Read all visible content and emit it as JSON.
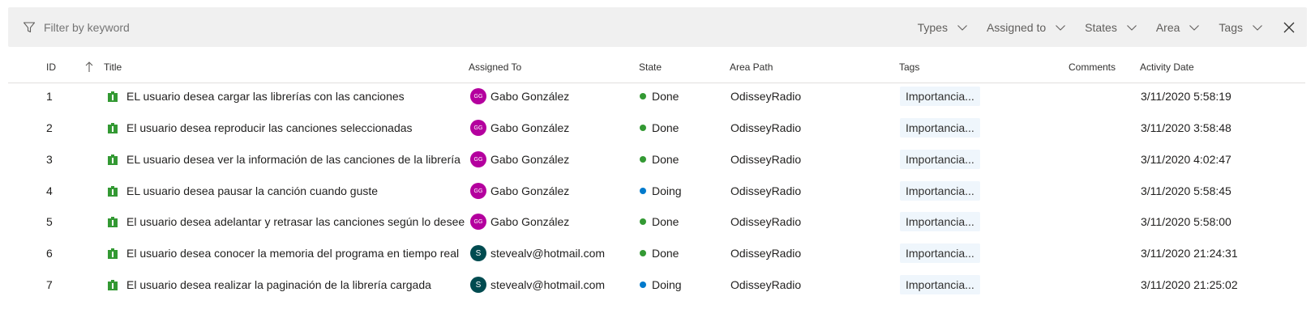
{
  "filter_bar": {
    "placeholder": "Filter by keyword",
    "dropdowns": [
      {
        "label": "Types"
      },
      {
        "label": "Assigned to"
      },
      {
        "label": "States"
      },
      {
        "label": "Area"
      },
      {
        "label": "Tags"
      }
    ]
  },
  "columns": {
    "id": "ID",
    "title": "Title",
    "assigned_to": "Assigned To",
    "state": "State",
    "area_path": "Area Path",
    "tags": "Tags",
    "comments": "Comments",
    "activity_date": "Activity Date"
  },
  "rows": [
    {
      "id": "1",
      "title": "EL usuario desea cargar las librerías con las canciones",
      "avatar": "GG",
      "assigned": "Gabo González",
      "state": "Done",
      "area": "OdisseyRadio",
      "tag": "Importancia...",
      "date": "3/11/2020 5:58:19"
    },
    {
      "id": "2",
      "title": "El usuario desea reproducir las canciones seleccionadas",
      "avatar": "GG",
      "assigned": "Gabo González",
      "state": "Done",
      "area": "OdisseyRadio",
      "tag": "Importancia...",
      "date": "3/11/2020 3:58:48"
    },
    {
      "id": "3",
      "title": "EL usuario desea ver la información de las canciones de la librería",
      "avatar": "GG",
      "assigned": "Gabo González",
      "state": "Done",
      "area": "OdisseyRadio",
      "tag": "Importancia...",
      "date": "3/11/2020 4:02:47"
    },
    {
      "id": "4",
      "title": "EL usuario desea pausar la canción cuando guste",
      "avatar": "GG",
      "assigned": "Gabo González",
      "state": "Doing",
      "area": "OdisseyRadio",
      "tag": "Importancia...",
      "date": "3/11/2020 5:58:45"
    },
    {
      "id": "5",
      "title": "El usuario desea adelantar y retrasar las canciones según lo desee",
      "avatar": "GG",
      "assigned": "Gabo González",
      "state": "Done",
      "area": "OdisseyRadio",
      "tag": "Importancia...",
      "date": "3/11/2020 5:58:00"
    },
    {
      "id": "6",
      "title": "El usuario desea conocer la memoria del programa en tiempo real",
      "avatar": "S",
      "assigned": "stevealv@hotmail.com",
      "state": "Done",
      "area": "OdisseyRadio",
      "tag": "Importancia...",
      "date": "3/11/2020 21:24:31"
    },
    {
      "id": "7",
      "title": "El usuario desea realizar la paginación de la librería cargada",
      "avatar": "S",
      "assigned": "stevealv@hotmail.com",
      "state": "Doing",
      "area": "OdisseyRadio",
      "tag": "Importancia...",
      "date": "3/11/2020 21:25:02"
    }
  ],
  "colors": {
    "done": "#339933",
    "doing": "#007acc",
    "avatar_gg": "#b4009e",
    "avatar_s": "#004b50",
    "work_item_icon": "#339933"
  },
  "icons": {
    "filter": "filter-icon",
    "chevron": "chevron-down-icon",
    "close": "close-icon",
    "sort": "sort-ascending-icon",
    "work_item": "user-story-icon"
  }
}
